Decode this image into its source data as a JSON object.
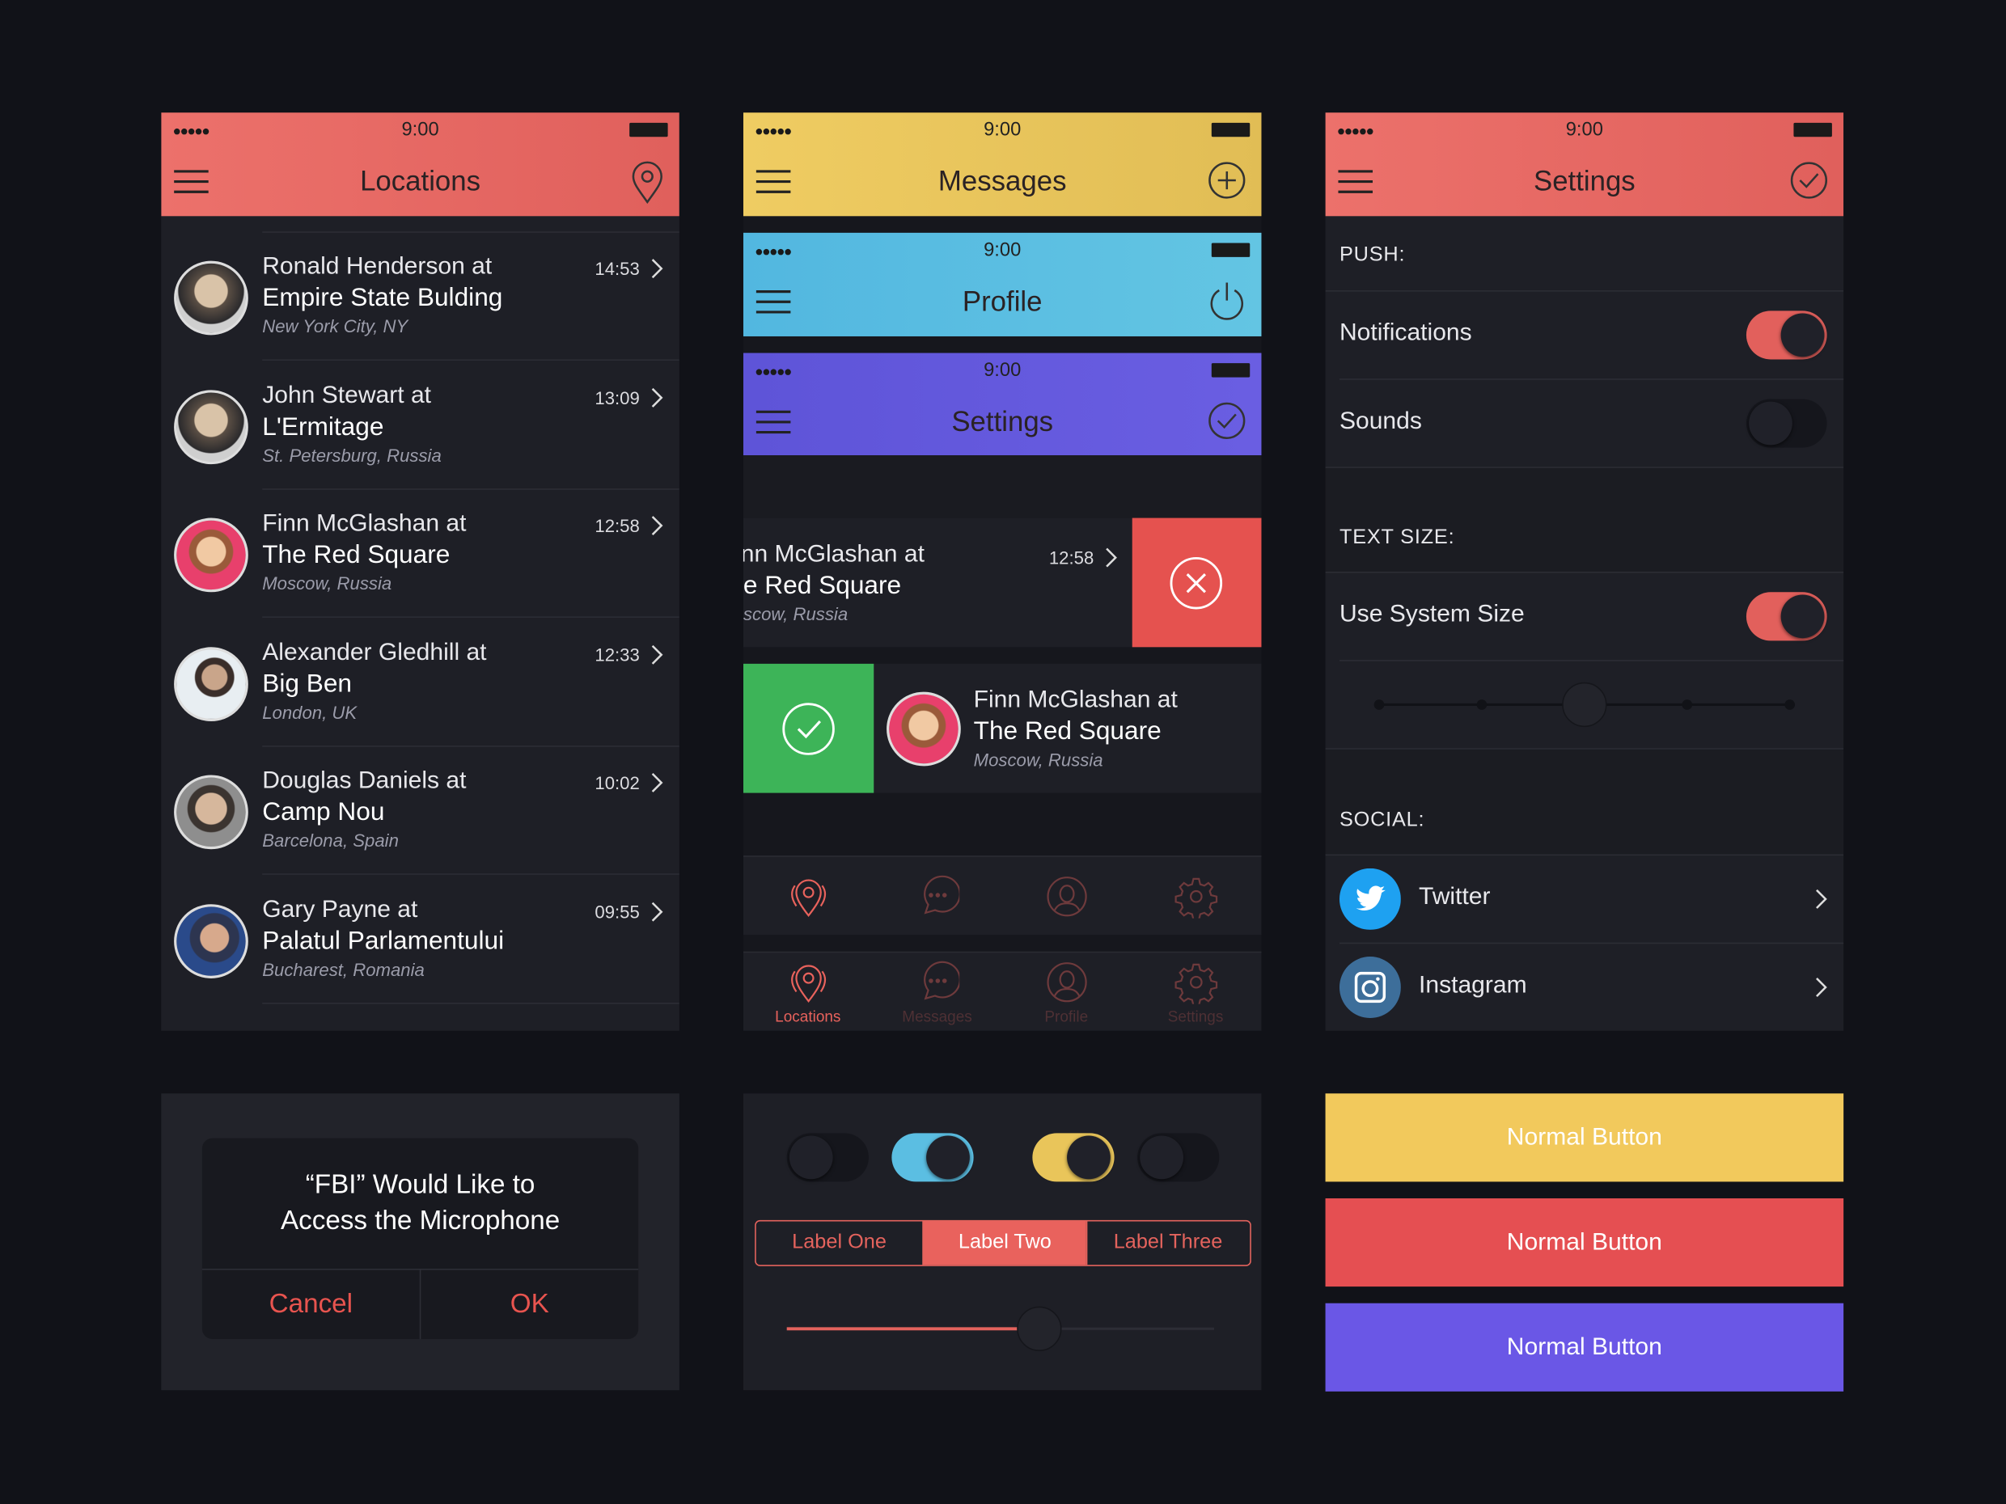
{
  "status": {
    "time": "9:00",
    "signal": "●●●●●"
  },
  "colors": {
    "red": "#e2605c",
    "yellow": "#e9c55a",
    "blue": "#5bbee2",
    "purple": "#6658e0",
    "green": "#3fb55a",
    "bg": "#1e1f26"
  },
  "locations": {
    "title": "Locations",
    "menu_icon": "hamburger-icon",
    "action_icon": "map-pin-icon",
    "items": [
      {
        "name": "Ronald Henderson at",
        "place": "Empire State Bulding",
        "city": "New York City, NY",
        "time": "14:53"
      },
      {
        "name": "John Stewart at",
        "place": "L'Ermitage",
        "city": "St. Petersburg, Russia",
        "time": "13:09"
      },
      {
        "name": "Finn McGlashan at",
        "place": "The Red Square",
        "city": "Moscow, Russia",
        "time": "12:58"
      },
      {
        "name": "Alexander Gledhill at",
        "place": "Big Ben",
        "city": "London, UK",
        "time": "12:33"
      },
      {
        "name": "Douglas Daniels at",
        "place": "Camp Nou",
        "city": "Barcelona, Spain",
        "time": "10:02"
      },
      {
        "name": "Gary Payne at",
        "place": "Palatul Parlamentului",
        "city": "Bucharest, Romania",
        "time": "09:55"
      }
    ]
  },
  "headers": {
    "messages": "Messages",
    "profile": "Profile",
    "settings": "Settings"
  },
  "swipe": {
    "left": {
      "name": "nn McGlashan at",
      "place": "e Red Square",
      "city": "scow, Russia",
      "time": "12:58"
    },
    "right": {
      "name": "Finn McGlashan at",
      "place": "The Red Square",
      "city": "Moscow, Russia"
    }
  },
  "tabbar": {
    "items": [
      "Locations",
      "Messages",
      "Profile",
      "Settings"
    ],
    "active": "Locations"
  },
  "settings": {
    "title": "Settings",
    "push": "PUSH:",
    "notifications": "Notifications",
    "sounds": "Sounds",
    "text_size": "TEXT SIZE:",
    "use_system_size": "Use System Size",
    "social": "SOCIAL:",
    "twitter": "Twitter",
    "instagram": "Instagram",
    "toggles": {
      "notifications": true,
      "sounds": false,
      "use_system_size": true
    },
    "text_size_level": 3,
    "text_size_steps": 5
  },
  "alert": {
    "line1": "“FBI” Would Like to",
    "line2": "Access the Microphone",
    "cancel": "Cancel",
    "ok": "OK"
  },
  "controls": {
    "toggles": [
      false,
      true,
      true,
      false
    ],
    "segments": [
      "Label One",
      "Label Two",
      "Label Three"
    ],
    "selected_segment": "Label Two",
    "slider_percent": 54
  },
  "buttons": [
    {
      "label": "Normal Button",
      "color": "#f2c95c"
    },
    {
      "label": "Normal Button",
      "color": "#e54f52"
    },
    {
      "label": "Normal Button",
      "color": "#6a57e6"
    }
  ]
}
